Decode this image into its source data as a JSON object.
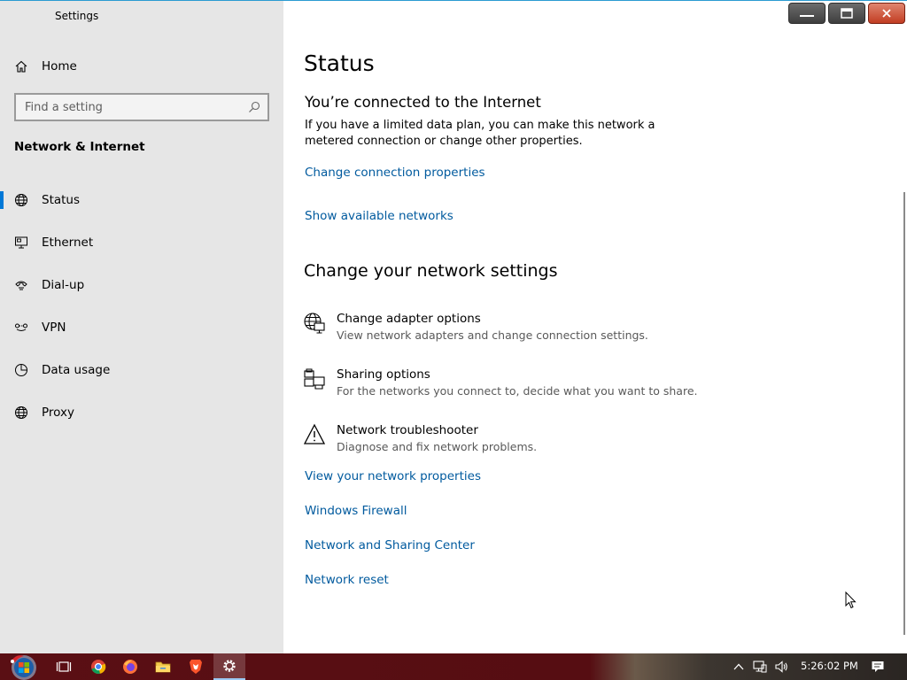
{
  "window": {
    "title": "Settings"
  },
  "sidebar": {
    "home_label": "Home",
    "search_placeholder": "Find a setting",
    "section": "Network & Internet",
    "items": [
      {
        "label": "Status",
        "icon": "globe-icon",
        "selected": true
      },
      {
        "label": "Ethernet",
        "icon": "monitor-icon"
      },
      {
        "label": "Dial-up",
        "icon": "phone-icon"
      },
      {
        "label": "VPN",
        "icon": "vpn-icon"
      },
      {
        "label": "Data usage",
        "icon": "data-usage-icon"
      },
      {
        "label": "Proxy",
        "icon": "globe-icon"
      }
    ]
  },
  "main": {
    "title": "Status",
    "connection": {
      "heading": "You’re connected to the Internet",
      "body": "If you have a limited data plan, you can make this network a metered connection or change other properties.",
      "link_properties": "Change connection properties",
      "link_networks": "Show available networks"
    },
    "change_settings": {
      "heading": "Change your network settings",
      "items": [
        {
          "title": "Change adapter options",
          "desc": "View network adapters and change connection settings.",
          "icon": "adapter-icon"
        },
        {
          "title": "Sharing options",
          "desc": "For the networks you connect to, decide what you want to share.",
          "icon": "sharing-icon"
        },
        {
          "title": "Network troubleshooter",
          "desc": "Diagnose and fix network problems.",
          "icon": "warning-icon"
        }
      ]
    },
    "links": [
      "View your network properties",
      "Windows Firewall",
      "Network and Sharing Center",
      "Network reset"
    ]
  },
  "taskbar": {
    "clock": "5:26:02 PM",
    "apps": [
      "start-icon",
      "task-view-icon",
      "chrome-icon",
      "firefox-icon",
      "file-explorer-icon",
      "brave-icon",
      "settings-gear-icon"
    ]
  },
  "colors": {
    "accent": "#0078d7",
    "link": "#005a9e",
    "sidebar_bg": "#e6e6e6",
    "taskbar": "#560d12"
  }
}
